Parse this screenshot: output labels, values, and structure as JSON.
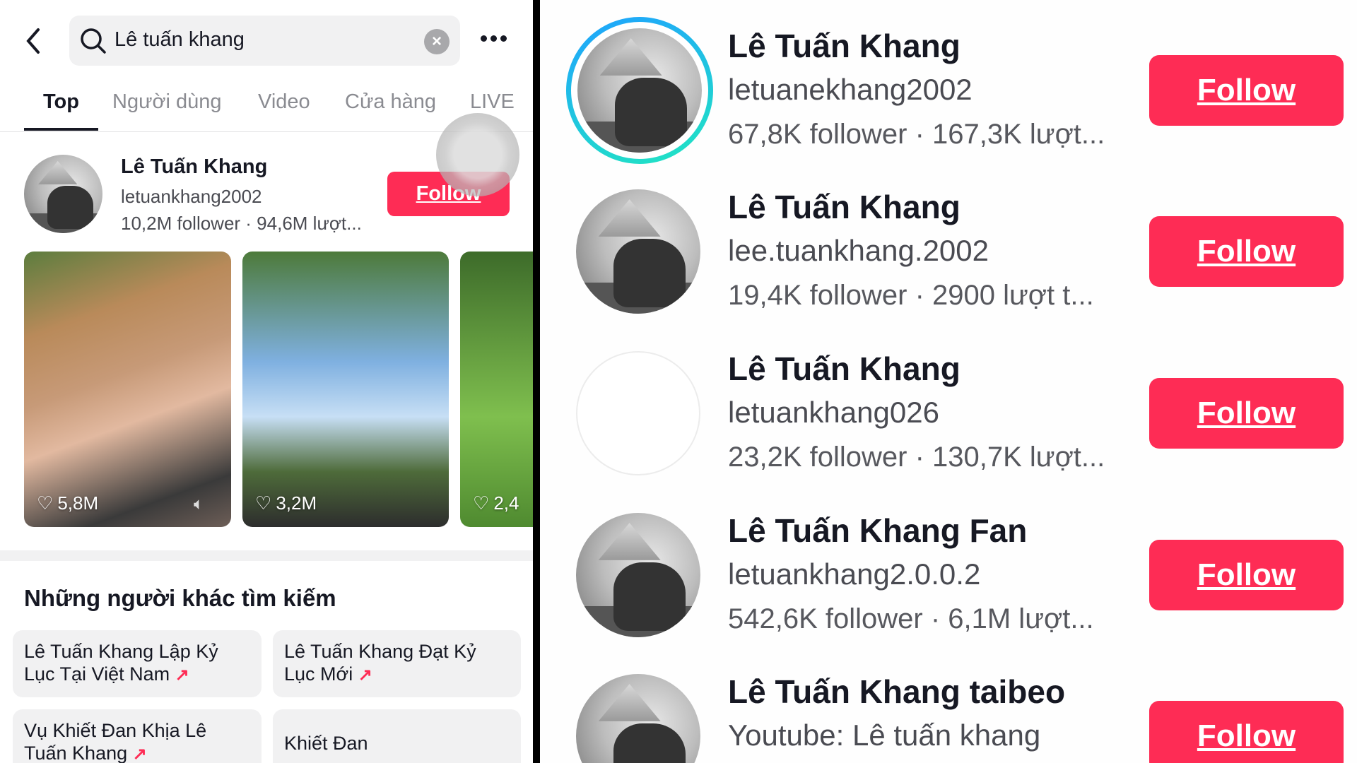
{
  "search": {
    "query": "Lê tuấn khang"
  },
  "tabs": [
    {
      "label": "Top",
      "active": true
    },
    {
      "label": "Người dùng"
    },
    {
      "label": "Video"
    },
    {
      "label": "Cửa hàng"
    },
    {
      "label": "LIVE"
    }
  ],
  "top_user": {
    "name": "Lê Tuấn Khang",
    "handle": "letuankhang2002",
    "stats": "10,2M follower · 94,6M lượt...",
    "follow_label": "Follow"
  },
  "videos": [
    {
      "likes": "5,8M"
    },
    {
      "likes": "3,2M"
    },
    {
      "likes": "2,4"
    }
  ],
  "others": {
    "heading": "Những người khác tìm kiếm",
    "items": [
      {
        "label": "Lê Tuấn Khang Lập Kỷ Lục Tại Việt Nam",
        "trending": true
      },
      {
        "label": "Lê Tuấn Khang Đạt Kỷ Lục Mới",
        "trending": true
      },
      {
        "label": "Vụ Khiết Đan Khịa Lê Tuấn Khang",
        "trending": true
      },
      {
        "label": "Khiết Đan",
        "trending": false
      }
    ]
  },
  "users": [
    {
      "name": "Lê Tuấn Khang",
      "handle": "letuanekhang2002",
      "stats": "67,8K follower · 167,3K lượt...",
      "follow_label": "Follow",
      "has_story": true
    },
    {
      "name": "Lê Tuấn Khang",
      "handle": "lee.tuankhang.2002",
      "stats": "19,4K follower · 2900 lượt t...",
      "follow_label": "Follow"
    },
    {
      "name": "Lê Tuấn Khang",
      "handle": "letuankhang026",
      "stats": "23,2K follower · 130,7K lượt...",
      "follow_label": "Follow",
      "blank_avatar": true
    },
    {
      "name": "Lê Tuấn Khang Fan",
      "handle": "letuankhang2.0.0.2",
      "stats": "542,6K follower · 6,1M lượt...",
      "follow_label": "Follow"
    },
    {
      "name": "Lê Tuấn Khang taibeo",
      "handle": "Youtube: Lê tuấn khang",
      "stats": "",
      "follow_label": "Follow"
    }
  ],
  "colors": {
    "accent": "#fe2c55",
    "story_ring_start": "#1fa2ff",
    "story_ring_end": "#21e6c1"
  }
}
